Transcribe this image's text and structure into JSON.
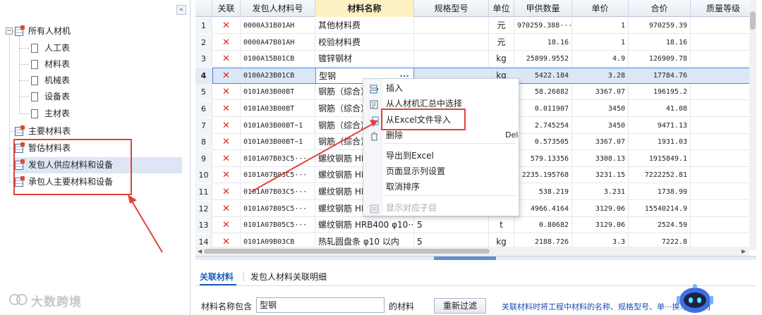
{
  "left_panel": {
    "collapse_label": "«",
    "tree": [
      {
        "label": "所有人材机",
        "level": 0,
        "icon": "table-icon",
        "expander": "⊟"
      },
      {
        "label": "人工表",
        "level": 1,
        "icon": "doc-icon"
      },
      {
        "label": "材料表",
        "level": 1,
        "icon": "doc-icon"
      },
      {
        "label": "机械表",
        "level": 1,
        "icon": "doc-icon"
      },
      {
        "label": "设备表",
        "level": 1,
        "icon": "doc-icon"
      },
      {
        "label": "主材表",
        "level": 1,
        "icon": "doc-icon"
      },
      {
        "label": "主要材料表",
        "level": 0,
        "icon": "table-icon"
      },
      {
        "label": "暂估材料表",
        "level": 0,
        "icon": "table-icon"
      },
      {
        "label": "发包人供应材料和设备",
        "level": 0,
        "icon": "table-icon",
        "selected": true
      },
      {
        "label": "承包人主要材料和设备",
        "level": 0,
        "icon": "table-icon"
      }
    ]
  },
  "grid": {
    "columns": [
      "",
      "关联",
      "发包人材料号",
      "材料名称",
      "规格型号",
      "单位",
      "甲供数量",
      "单价",
      "合价",
      "质量等级"
    ],
    "active_column": "材料名称",
    "rows": [
      {
        "num": "1",
        "code": "0000A31B01AH",
        "name": "其他材料费",
        "spec": "",
        "unit": "元",
        "qty": "970259.388···",
        "price": "1",
        "total": "970259.39"
      },
      {
        "num": "2",
        "code": "0000A47B01AH",
        "name": "校验材料费",
        "spec": "",
        "unit": "元",
        "qty": "18.16",
        "price": "1",
        "total": "18.16"
      },
      {
        "num": "3",
        "code": "0100A15B01CB",
        "name": "镀锌钢材",
        "spec": "",
        "unit": "kg",
        "qty": "25899.9552",
        "price": "4.9",
        "total": "126909.78"
      },
      {
        "num": "4",
        "code": "0100A23B01CB",
        "name": "型钢",
        "spec": "",
        "unit": "kg",
        "qty": "5422.184",
        "price": "3.28",
        "total": "17784.76",
        "selected": true
      },
      {
        "num": "5",
        "code": "0101A03B00BT",
        "name": "钢筋（综合）",
        "spec": "",
        "unit": "",
        "qty": "58.26882",
        "price": "3367.07",
        "total": "196195.2"
      },
      {
        "num": "6",
        "code": "0101A03B00BT",
        "name": "钢筋（综合）",
        "spec": "",
        "unit": "",
        "qty": "0.011907",
        "price": "3450",
        "total": "41.08"
      },
      {
        "num": "7",
        "code": "0101A03B00BT~1",
        "name": "钢筋（综合）",
        "spec": "",
        "unit": "",
        "qty": "2.745254",
        "price": "3450",
        "total": "9471.13"
      },
      {
        "num": "8",
        "code": "0101A03B00BT~1",
        "name": "钢筋（综合）",
        "spec": "",
        "unit": "",
        "qty": "0.573505",
        "price": "3367.07",
        "total": "1931.03"
      },
      {
        "num": "9",
        "code": "0101A07B03C5···",
        "name": "螺纹钢筋 HRB",
        "spec": "",
        "unit": "",
        "qty": "579.13356",
        "price": "3308.13",
        "total": "1915849.1"
      },
      {
        "num": "10",
        "code": "0101A07B03C5···",
        "name": "螺纹钢筋 HRB",
        "spec": "",
        "unit": "",
        "qty": "2235.195768",
        "price": "3231.15",
        "total": "7222252.81"
      },
      {
        "num": "11",
        "code": "0101A07B03C5···",
        "name": "螺纹钢筋 HRB",
        "spec": "",
        "unit": "",
        "qty": "538.219",
        "price": "3.231",
        "total": "1738.99"
      },
      {
        "num": "12",
        "code": "0101A07B05C5···",
        "name": "螺纹钢筋 HRB",
        "spec": "",
        "unit": "",
        "qty": "4966.4164",
        "price": "3129.06",
        "total": "15540214.9"
      },
      {
        "num": "13",
        "code": "0101A07B05C5···",
        "name": "螺纹钢筋 HRB400 φ10···",
        "spec": "5",
        "unit": "t",
        "qty": "0.80682",
        "price": "3129.06",
        "total": "2524.59"
      },
      {
        "num": "14",
        "code": "0101A09B03CB",
        "name": "热轧圆盘条 φ10 以内",
        "spec": "5",
        "unit": "kg",
        "qty": "2188.726",
        "price": "3.3",
        "total": "7222.8"
      }
    ],
    "relation_mark": "✕",
    "ellipsis": "···"
  },
  "context_menu": {
    "items": [
      {
        "label": "插入",
        "icon": "insert-icon",
        "key": ""
      },
      {
        "label": "从人材机汇总中选择",
        "icon": "select-list-icon",
        "key": ""
      },
      {
        "label": "从Excel文件导入",
        "icon": "import-excel-icon",
        "key": "",
        "highlighted": true
      },
      {
        "label": "删除",
        "icon": "delete-icon",
        "key": "Del"
      },
      {
        "label": "导出到Excel",
        "icon": "",
        "key": ""
      },
      {
        "label": "页面显示列设置",
        "icon": "",
        "key": ""
      },
      {
        "label": "取消排序",
        "icon": "",
        "key": ""
      },
      {
        "label": "显示对应子目",
        "icon": "show-subitem-icon",
        "key": "",
        "disabled": true
      }
    ]
  },
  "bottom_panel": {
    "tabs": [
      "关联材料",
      "发包人材料关联明细"
    ],
    "active_tab": "关联材料",
    "filter_label": "材料名称包含",
    "filter_value": "型钢",
    "filter_suffix": "的材料",
    "refilter_button": "重新过滤",
    "tip_text": "关联材料时将工程中材料的名称、规格型号、单···换与招标材"
  },
  "watermark": "大数跨境",
  "colors": {
    "accent": "#1b5fbe",
    "highlight_box": "#e0423a",
    "relation_mark": "#e02020",
    "selected_row": "#dbe7f7",
    "active_header": "#fdf1c4"
  }
}
